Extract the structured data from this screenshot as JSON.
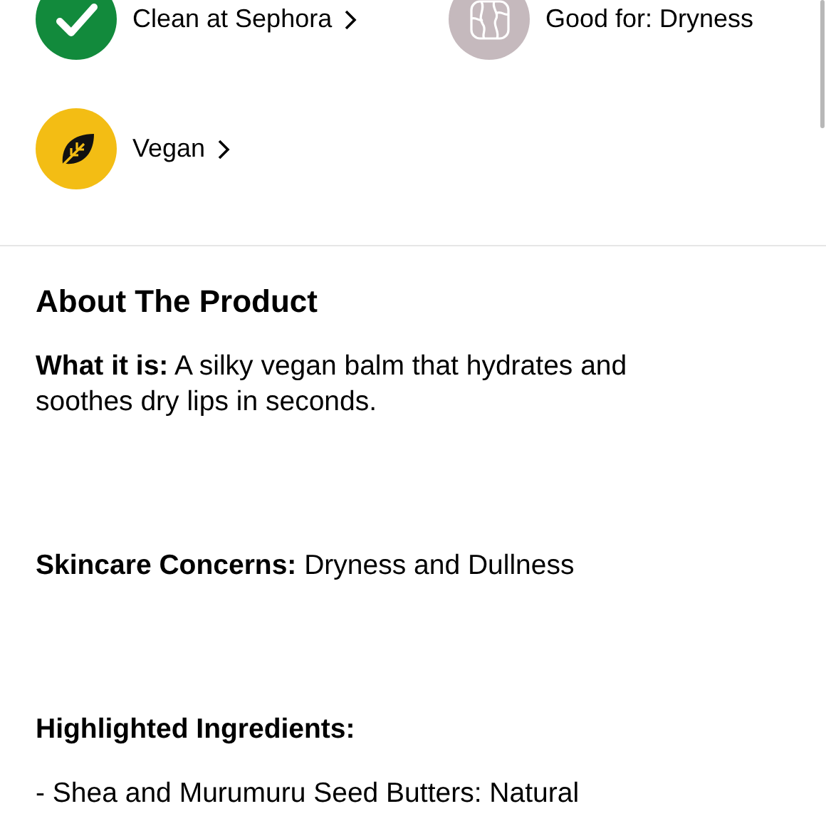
{
  "badges": [
    {
      "label": "Clean at Sephora",
      "kind": "check",
      "color": "#128a3c",
      "link": true
    },
    {
      "label": "Good for: Dryness",
      "kind": "skin",
      "color": "#c5b9bd",
      "link": false
    },
    {
      "label": "Vegan",
      "kind": "leaf",
      "color": "#f3bd14",
      "link": true
    }
  ],
  "about": {
    "title": "About The Product",
    "paragraphs": [
      {
        "kind": "text",
        "text": "**What it is:** A silky vegan balm that hydrates and soothes dry lips in seconds."
      },
      {
        "kind": "text",
        "text": "**Skincare Concerns:** Dryness and Dullness"
      },
      {
        "kind": "label",
        "text": "Highlighted Ingredients:"
      },
      {
        "kind": "item",
        "text": "- Shea and Murumuru Seed Butters: Natural"
      }
    ]
  }
}
